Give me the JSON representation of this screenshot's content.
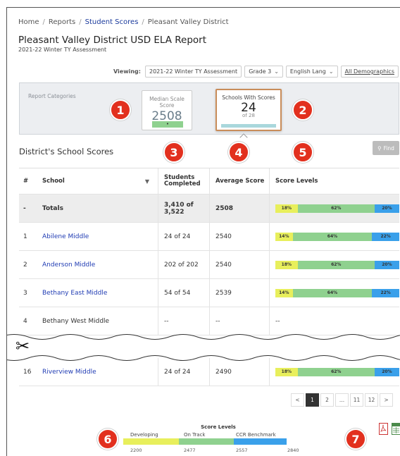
{
  "breadcrumb": [
    "Home",
    "Reports",
    "Student Scores",
    "Pleasant Valley District"
  ],
  "title": "Pleasant Valley District USD ELA Report",
  "subtitle": "2021-22 Winter TY Assessment",
  "viewing": {
    "label": "Viewing:",
    "assessment": "2021-22 Winter TY Assessment",
    "grade": "Grade 3",
    "subject": "English Lang",
    "demographics": "All Demographics"
  },
  "categories": {
    "label": "Report Categories",
    "card1": {
      "heading": "Median Scale Score",
      "value": "2508",
      "bar": "•"
    },
    "card2": {
      "heading": "Schools With Scores",
      "value": "24",
      "of": "of 28"
    }
  },
  "section_title": "District's School Scores",
  "find_label": "Find",
  "table": {
    "headers": {
      "num": "#",
      "school": "School",
      "students": "Students Completed",
      "avg": "Average Score",
      "levels": "Score Levels"
    },
    "rows": [
      {
        "num": "-",
        "school": "Totals",
        "students": "3,410 of 3,522",
        "avg": "2508",
        "levels": [
          18,
          62,
          20
        ],
        "total": true
      },
      {
        "num": "1",
        "school": "Abilene Middle",
        "students": "24 of 24",
        "avg": "2540",
        "levels": [
          14,
          64,
          22
        ],
        "link": true
      },
      {
        "num": "2",
        "school": "Anderson Middle",
        "students": "202 of 202",
        "avg": "2540",
        "levels": [
          18,
          62,
          20
        ],
        "link": true
      },
      {
        "num": "3",
        "school": "Bethany East Middle",
        "students": "54 of 54",
        "avg": "2539",
        "levels": [
          14,
          64,
          22
        ],
        "link": true
      },
      {
        "num": "4",
        "school": "Bethany West Middle",
        "students": "--",
        "avg": "--",
        "levels": null,
        "levels_text": "--"
      }
    ],
    "last_row": {
      "num": "16",
      "school": "Riverview Middle",
      "students": "24 of 24",
      "avg": "2490",
      "levels": [
        18,
        62,
        20
      ]
    }
  },
  "pagination": [
    "<",
    "1",
    "2",
    "...",
    "11",
    "12",
    ">"
  ],
  "legend": {
    "title": "Score Levels",
    "labels": [
      "Developing",
      "On Track",
      "CCR Benchmark"
    ],
    "ticks": [
      "2200",
      "2477",
      "2557",
      "2840"
    ]
  },
  "badges": [
    "1",
    "2",
    "3",
    "4",
    "5",
    "6",
    "7"
  ],
  "colors": {
    "developing": "#e8ef5c",
    "on_track": "#8fd18f",
    "ccr": "#3aa0ea",
    "badge": "#e2301e",
    "link": "#1f3bb3"
  },
  "icons": {
    "scissors": "scissors-icon",
    "pdf": "pdf-export-icon",
    "excel": "excel-export-icon",
    "search": "search-icon"
  }
}
